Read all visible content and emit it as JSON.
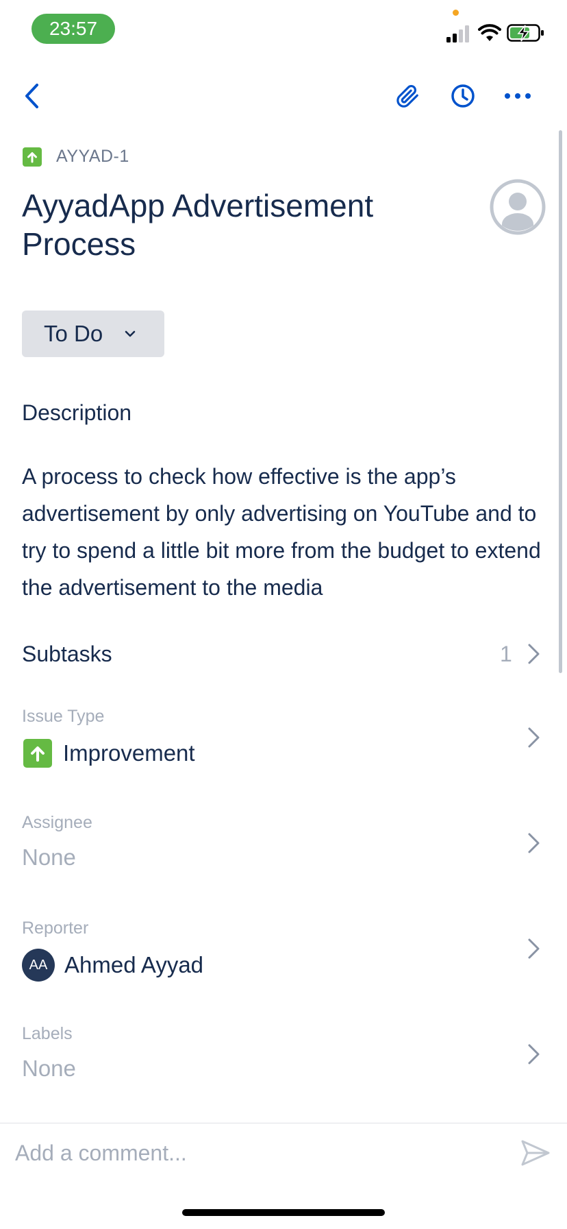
{
  "status_bar": {
    "time": "23:57"
  },
  "colors": {
    "accent": "#0052cc",
    "status_pill": "#4caf50",
    "improvement": "#65ba43",
    "text": "#172b4d",
    "muted": "#a5adba",
    "dot": "#f5a623"
  },
  "nav": {
    "back_icon": "chevron-left-icon",
    "actions": [
      "paperclip-icon",
      "clock-icon",
      "more-icon"
    ]
  },
  "issue": {
    "key": "AYYAD-1",
    "title": "AyyadApp Advertisement Process",
    "status": "To Do"
  },
  "description": {
    "heading": "Description",
    "text": "A process to check how effective is the app’s advertisement by only advertising on YouTube and to try to spend a little bit more from the budget to extend the advertisement to the media"
  },
  "subtasks": {
    "heading": "Subtasks",
    "count": "1"
  },
  "fields": {
    "issue_type": {
      "label": "Issue Type",
      "value": "Improvement"
    },
    "assignee": {
      "label": "Assignee",
      "value": "None"
    },
    "reporter": {
      "label": "Reporter",
      "value": "Ahmed Ayyad",
      "initials": "AA"
    },
    "labels": {
      "label": "Labels",
      "value": "None"
    }
  },
  "comment": {
    "placeholder": "Add a comment..."
  }
}
